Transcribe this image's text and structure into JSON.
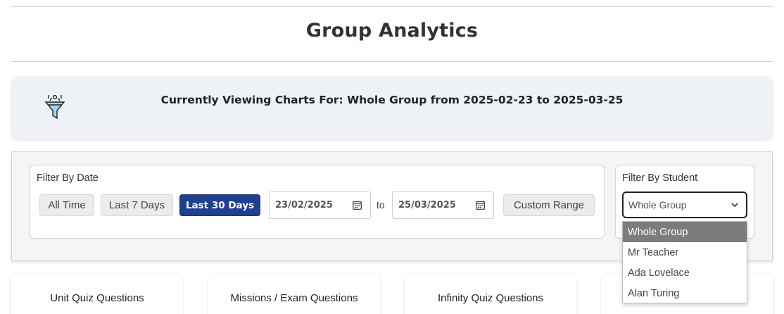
{
  "page": {
    "title": "Group Analytics"
  },
  "viewing": {
    "icon": "funnel-filter-icon",
    "text": "Currently Viewing Charts For: Whole Group from 2025-02-23 to 2025-03-25"
  },
  "date_filter": {
    "label": "Filter By Date",
    "buttons": {
      "all_time": "All Time",
      "last_7": "Last 7 Days",
      "last_30": "Last 30 Days",
      "custom": "Custom Range"
    },
    "active_button": "Last 30 Days",
    "from_date": "23/02/2025",
    "to_label": "to",
    "to_date": "25/03/2025",
    "calendar_icon": "calendar-icon"
  },
  "student_filter": {
    "label": "Filter By Student",
    "selected": "Whole Group",
    "chevron_icon": "chevron-down-icon",
    "options": [
      "Whole Group",
      "Mr Teacher",
      "Ada Lovelace",
      "Alan Turing"
    ]
  },
  "cards": [
    {
      "title": "Unit Quiz Questions"
    },
    {
      "title": "Missions / Exam Questions"
    },
    {
      "title": "Infinity Quiz Questions"
    },
    {
      "title": ""
    }
  ],
  "colors": {
    "active_button": "#1f3f8f",
    "selected_option": "#7c7c7c",
    "viewing_bg": "#eef2f7"
  }
}
